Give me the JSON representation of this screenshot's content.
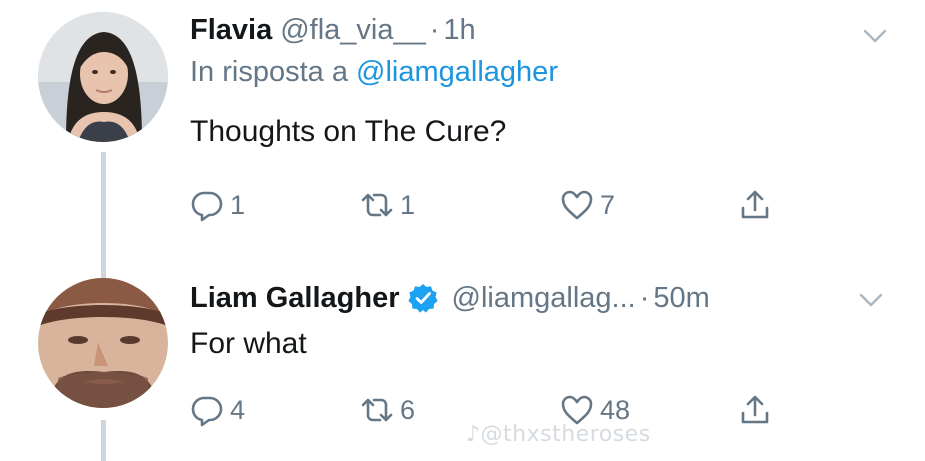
{
  "tweets": [
    {
      "display_name": "Flavia",
      "handle": "@fla_via__",
      "separator": "·",
      "time": "1h",
      "reply_prefix": "In risposta a",
      "reply_mention": "@liamgallagher",
      "text": "Thoughts on The Cure?",
      "verified": false,
      "stats": {
        "replies": "1",
        "retweets": "1",
        "likes": "7"
      }
    },
    {
      "display_name": "Liam Gallagher",
      "handle": "@liamgallag...",
      "separator": "·",
      "time": "50m",
      "text": "For what",
      "verified": true,
      "stats": {
        "replies": "4",
        "retweets": "6",
        "likes": "48"
      }
    }
  ],
  "watermark": "♪@thxstheroses",
  "icons": {
    "reply": "reply-icon",
    "retweet": "retweet-icon",
    "like": "heart-icon",
    "share": "share-icon",
    "caret": "chevron-down-icon",
    "verified": "verified-badge-icon"
  },
  "colors": {
    "link": "#1b95e0",
    "secondary_text": "#657786",
    "thread_line": "#ccd6dd",
    "verified": "#1da1f2"
  }
}
